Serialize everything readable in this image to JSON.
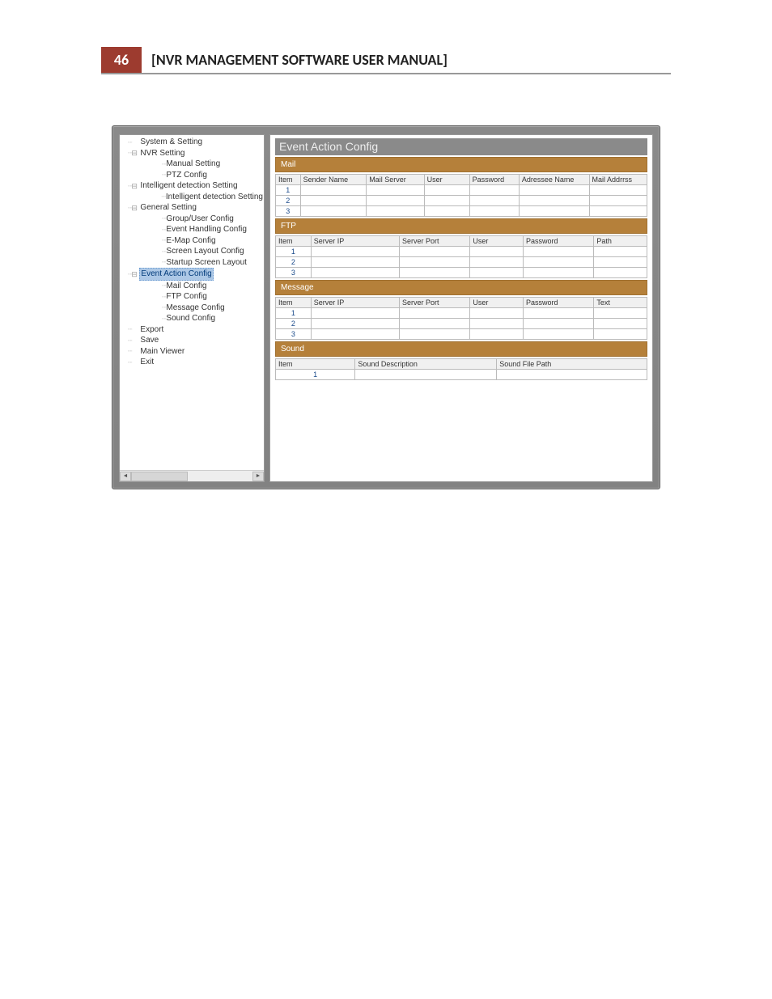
{
  "header": {
    "page_number": "46",
    "title": "[NVR MANAGEMENT SOFTWARE USER MANUAL]"
  },
  "tree": [
    {
      "lvl": 0,
      "exp": "",
      "label": "System & Setting"
    },
    {
      "lvl": 0,
      "exp": "⊟",
      "label": "NVR  Setting"
    },
    {
      "lvl": 2,
      "exp": "",
      "label": "Manual Setting"
    },
    {
      "lvl": 2,
      "exp": "",
      "label": "PTZ Config"
    },
    {
      "lvl": 0,
      "exp": "⊟",
      "label": "Intelligent detection Setting"
    },
    {
      "lvl": 2,
      "exp": "",
      "label": "Intelligent detection Setting"
    },
    {
      "lvl": 0,
      "exp": "⊟",
      "label": "General Setting"
    },
    {
      "lvl": 2,
      "exp": "",
      "label": "Group/User Config"
    },
    {
      "lvl": 2,
      "exp": "",
      "label": "Event Handling Config"
    },
    {
      "lvl": 2,
      "exp": "",
      "label": "E-Map Config"
    },
    {
      "lvl": 2,
      "exp": "",
      "label": "Screen Layout Config"
    },
    {
      "lvl": 2,
      "exp": "",
      "label": "Startup Screen Layout"
    },
    {
      "lvl": 0,
      "exp": "⊟",
      "label": "Event Action Config",
      "selected": true
    },
    {
      "lvl": 2,
      "exp": "",
      "label": "Mail Config"
    },
    {
      "lvl": 2,
      "exp": "",
      "label": "FTP Config"
    },
    {
      "lvl": 2,
      "exp": "",
      "label": "Message Config"
    },
    {
      "lvl": 2,
      "exp": "",
      "label": "Sound Config"
    },
    {
      "lvl": 0,
      "exp": "",
      "label": "Export"
    },
    {
      "lvl": 0,
      "exp": "",
      "label": "Save"
    },
    {
      "lvl": 0,
      "exp": "",
      "label": "Main Viewer"
    },
    {
      "lvl": 0,
      "exp": "",
      "label": "Exit"
    }
  ],
  "content": {
    "title": "Event Action Config",
    "sections": {
      "mail": {
        "title": "Mail",
        "cols": [
          "Item",
          "Sender Name",
          "Mail Server",
          "User",
          "Password",
          "Adressee Name",
          "Mail Addrrss"
        ],
        "widths": [
          "30px",
          "80px",
          "70px",
          "55px",
          "60px",
          "85px",
          "70px"
        ],
        "rows": [
          [
            "1",
            "",
            "",
            "",
            "",
            "",
            ""
          ],
          [
            "2",
            "",
            "",
            "",
            "",
            "",
            ""
          ],
          [
            "3",
            "",
            "",
            "",
            "",
            "",
            ""
          ]
        ]
      },
      "ftp": {
        "title": "FTP",
        "cols": [
          "Item",
          "Server IP",
          "Server Port",
          "User",
          "Password",
          "Path"
        ],
        "widths": [
          "40px",
          "100px",
          "80px",
          "60px",
          "80px",
          "60px"
        ],
        "rows": [
          [
            "1",
            "",
            "",
            "",
            "",
            ""
          ],
          [
            "2",
            "",
            "",
            "",
            "",
            ""
          ],
          [
            "3",
            "",
            "",
            "",
            "",
            ""
          ]
        ]
      },
      "message": {
        "title": "Message",
        "cols": [
          "Item",
          "Server IP",
          "Server Port",
          "User",
          "Password",
          "Text"
        ],
        "widths": [
          "40px",
          "100px",
          "80px",
          "60px",
          "80px",
          "60px"
        ],
        "rows": [
          [
            "1",
            "",
            "",
            "",
            "",
            ""
          ],
          [
            "2",
            "",
            "",
            "",
            "",
            ""
          ],
          [
            "3",
            "",
            "",
            "",
            "",
            ""
          ]
        ]
      },
      "sound": {
        "title": "Sound",
        "cols": [
          "Item",
          "Sound Description",
          "Sound File Path"
        ],
        "widths": [
          "90px",
          "160px",
          "170px"
        ],
        "rows": [
          [
            "1",
            "",
            ""
          ]
        ]
      }
    }
  }
}
